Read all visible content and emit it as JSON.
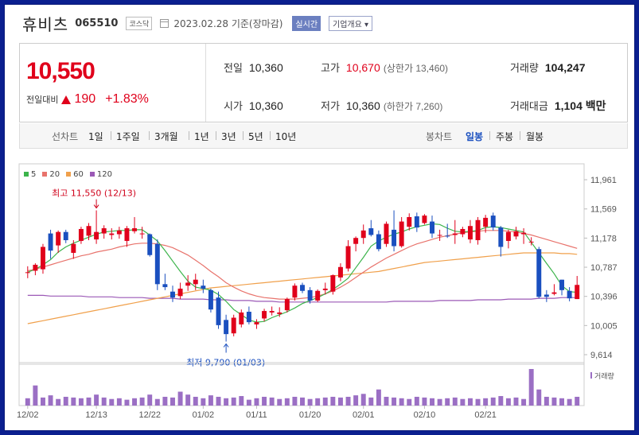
{
  "header": {
    "name": "휴비츠",
    "code": "065510",
    "market": "코스닥",
    "date_text": "2023.02.28 기준(장마감)",
    "realtime_label": "실시간",
    "company_label": "기업개요 ▾"
  },
  "price": {
    "current": "10,550",
    "change_label": "전일대비",
    "change": "190",
    "change_pct": "+1.83%"
  },
  "metrics": {
    "prev_close_label": "전일",
    "prev_close": "10,360",
    "high_label": "고가",
    "high": "10,670",
    "upper_limit": "(상한가 13,460)",
    "volume_label": "거래량",
    "volume": "104,247",
    "open_label": "시가",
    "open": "10,360",
    "low_label": "저가",
    "low": "10,360",
    "lower_limit": "(하한가 7,260)",
    "amount_label": "거래대금",
    "amount": "1,104 백만"
  },
  "periods": {
    "line_label": "선차트",
    "line_items": [
      "1일",
      "1주일",
      "3개월",
      "1년",
      "3년",
      "5년",
      "10년"
    ],
    "candle_label": "봉차트",
    "candle_items": [
      "일봉",
      "주봉",
      "월봉"
    ],
    "candle_active": "일봉"
  },
  "colors": {
    "up": "#e0001b",
    "down": "#1a4fbf",
    "ma5": "#3cb44b",
    "ma20": "#e8736c",
    "ma60": "#f0a04b",
    "ma120": "#9b59b6",
    "volume": "#9b6fc4"
  },
  "chart_data": {
    "type": "candlestick",
    "legend": [
      "5",
      "20",
      "60",
      "120"
    ],
    "y_ticks": [
      "11,961",
      "11,569",
      "11,178",
      "10,787",
      "10,396",
      "10,005",
      "9,614"
    ],
    "ylim": [
      9614,
      11961
    ],
    "x_ticks": [
      "12/02",
      "12/13",
      "12/22",
      "01/02",
      "01/11",
      "01/20",
      "02/01",
      "02/10",
      "02/21"
    ],
    "annotations": {
      "high": "최고 11,550 (12/13)",
      "low": "최저 9,790 (01/03)"
    },
    "volume_label": "거래량",
    "candles": [
      {
        "o": 10720,
        "h": 10800,
        "l": 10640,
        "c": 10720
      },
      {
        "o": 10740,
        "h": 10840,
        "l": 10680,
        "c": 10820
      },
      {
        "o": 10760,
        "h": 11100,
        "l": 10700,
        "c": 11060
      },
      {
        "o": 11240,
        "h": 11290,
        "l": 10900,
        "c": 11010
      },
      {
        "o": 11080,
        "h": 11280,
        "l": 10980,
        "c": 11260
      },
      {
        "o": 11260,
        "h": 11290,
        "l": 11110,
        "c": 11150
      },
      {
        "o": 10980,
        "h": 11150,
        "l": 10900,
        "c": 11100
      },
      {
        "o": 11140,
        "h": 11330,
        "l": 11100,
        "c": 11300
      },
      {
        "o": 11210,
        "h": 11380,
        "l": 11150,
        "c": 11340
      },
      {
        "o": 11160,
        "h": 11550,
        "l": 11100,
        "c": 11260
      },
      {
        "o": 11240,
        "h": 11350,
        "l": 11170,
        "c": 11310
      },
      {
        "o": 11220,
        "h": 11310,
        "l": 11160,
        "c": 11240
      },
      {
        "o": 11230,
        "h": 11330,
        "l": 11170,
        "c": 11280
      },
      {
        "o": 11140,
        "h": 11340,
        "l": 11060,
        "c": 11310
      },
      {
        "o": 11270,
        "h": 11460,
        "l": 11240,
        "c": 11310
      },
      {
        "o": 11230,
        "h": 11330,
        "l": 11170,
        "c": 11240
      },
      {
        "o": 11230,
        "h": 11240,
        "l": 10930,
        "c": 10950
      },
      {
        "o": 11100,
        "h": 11160,
        "l": 10480,
        "c": 10560
      },
      {
        "o": 10560,
        "h": 10700,
        "l": 10480,
        "c": 10520
      },
      {
        "o": 10460,
        "h": 10540,
        "l": 10320,
        "c": 10380
      },
      {
        "o": 10400,
        "h": 10580,
        "l": 10360,
        "c": 10500
      },
      {
        "o": 10540,
        "h": 10680,
        "l": 10470,
        "c": 10580
      },
      {
        "o": 10560,
        "h": 10700,
        "l": 10480,
        "c": 10620
      },
      {
        "o": 10540,
        "h": 10620,
        "l": 10440,
        "c": 10500
      },
      {
        "o": 10480,
        "h": 10500,
        "l": 10180,
        "c": 10220
      },
      {
        "o": 10380,
        "h": 10460,
        "l": 9960,
        "c": 10010
      },
      {
        "o": 10080,
        "h": 10150,
        "l": 9790,
        "c": 9890
      },
      {
        "o": 9900,
        "h": 10150,
        "l": 9860,
        "c": 10110
      },
      {
        "o": 10020,
        "h": 10220,
        "l": 9980,
        "c": 10180
      },
      {
        "o": 10190,
        "h": 10260,
        "l": 10020,
        "c": 10050
      },
      {
        "o": 10020,
        "h": 10090,
        "l": 9960,
        "c": 10050
      },
      {
        "o": 10100,
        "h": 10230,
        "l": 10060,
        "c": 10200
      },
      {
        "o": 10180,
        "h": 10260,
        "l": 10140,
        "c": 10200
      },
      {
        "o": 10160,
        "h": 10250,
        "l": 10120,
        "c": 10180
      },
      {
        "o": 10210,
        "h": 10380,
        "l": 10180,
        "c": 10360
      },
      {
        "o": 10380,
        "h": 10570,
        "l": 10340,
        "c": 10540
      },
      {
        "o": 10550,
        "h": 10580,
        "l": 10440,
        "c": 10470
      },
      {
        "o": 10480,
        "h": 10520,
        "l": 10300,
        "c": 10340
      },
      {
        "o": 10340,
        "h": 10490,
        "l": 10320,
        "c": 10470
      },
      {
        "o": 10480,
        "h": 10580,
        "l": 10420,
        "c": 10500
      },
      {
        "o": 10460,
        "h": 10690,
        "l": 10420,
        "c": 10680
      },
      {
        "o": 10650,
        "h": 10840,
        "l": 10600,
        "c": 10790
      },
      {
        "o": 10770,
        "h": 11150,
        "l": 10730,
        "c": 11070
      },
      {
        "o": 11100,
        "h": 11200,
        "l": 11000,
        "c": 11180
      },
      {
        "o": 11180,
        "h": 11360,
        "l": 11100,
        "c": 11280
      },
      {
        "o": 11310,
        "h": 11420,
        "l": 11200,
        "c": 11220
      },
      {
        "o": 11230,
        "h": 11280,
        "l": 11000,
        "c": 11030
      },
      {
        "o": 11100,
        "h": 11400,
        "l": 11060,
        "c": 11370
      },
      {
        "o": 11290,
        "h": 11550,
        "l": 11000,
        "c": 11070
      },
      {
        "o": 11070,
        "h": 11460,
        "l": 11050,
        "c": 11400
      },
      {
        "o": 11330,
        "h": 11510,
        "l": 11280,
        "c": 11460
      },
      {
        "o": 11470,
        "h": 11520,
        "l": 11260,
        "c": 11320
      },
      {
        "o": 11380,
        "h": 11500,
        "l": 11360,
        "c": 11480
      },
      {
        "o": 11400,
        "h": 11480,
        "l": 11180,
        "c": 11240
      },
      {
        "o": 11210,
        "h": 11290,
        "l": 11140,
        "c": 11220
      },
      {
        "o": 11210,
        "h": 11370,
        "l": 11180,
        "c": 11200
      },
      {
        "o": 11220,
        "h": 11420,
        "l": 11100,
        "c": 11240
      },
      {
        "o": 11230,
        "h": 11330,
        "l": 11190,
        "c": 11300
      },
      {
        "o": 11160,
        "h": 11420,
        "l": 11110,
        "c": 11340
      },
      {
        "o": 11150,
        "h": 11460,
        "l": 11090,
        "c": 11420
      },
      {
        "o": 11330,
        "h": 11490,
        "l": 11250,
        "c": 11450
      },
      {
        "o": 11480,
        "h": 11520,
        "l": 11280,
        "c": 11320
      },
      {
        "o": 11320,
        "h": 11340,
        "l": 10930,
        "c": 11060
      },
      {
        "o": 11140,
        "h": 11290,
        "l": 11040,
        "c": 11260
      },
      {
        "o": 11200,
        "h": 11330,
        "l": 11160,
        "c": 11270
      },
      {
        "o": 11230,
        "h": 11310,
        "l": 11100,
        "c": 11250
      },
      {
        "o": 11130,
        "h": 11190,
        "l": 11080,
        "c": 11130
      },
      {
        "o": 11030,
        "h": 11060,
        "l": 10370,
        "c": 10390
      },
      {
        "o": 10420,
        "h": 10480,
        "l": 10320,
        "c": 10390
      },
      {
        "o": 10430,
        "h": 10560,
        "l": 10410,
        "c": 10450
      },
      {
        "o": 10620,
        "h": 10620,
        "l": 10410,
        "c": 10480
      },
      {
        "o": 10470,
        "h": 10520,
        "l": 10330,
        "c": 10370
      },
      {
        "o": 10360,
        "h": 10670,
        "l": 10360,
        "c": 10550
      }
    ],
    "ma5": [
      10720,
      10760,
      10820,
      10890,
      10990,
      11060,
      11110,
      11150,
      11190,
      11230,
      11260,
      11270,
      11280,
      11280,
      11290,
      11290,
      11220,
      11140,
      11010,
      10870,
      10730,
      10600,
      10520,
      10500,
      10480,
      10420,
      10330,
      10220,
      10150,
      10080,
      10050,
      10060,
      10110,
      10150,
      10190,
      10240,
      10300,
      10340,
      10380,
      10430,
      10490,
      10560,
      10640,
      10780,
      10920,
      11070,
      11140,
      11190,
      11230,
      11260,
      11300,
      11330,
      11350,
      11370,
      11360,
      11310,
      11270,
      11260,
      11270,
      11280,
      11320,
      11330,
      11320,
      11300,
      11280,
      11260,
      11120,
      10980,
      10840,
      10700,
      10540,
      10460,
      10450
    ],
    "ma20": [
      10740,
      10760,
      10790,
      10820,
      10850,
      10880,
      10910,
      10940,
      10960,
      10990,
      11010,
      11030,
      11060,
      11080,
      11100,
      11110,
      11110,
      11100,
      11080,
      11050,
      11000,
      10950,
      10880,
      10810,
      10730,
      10660,
      10580,
      10520,
      10470,
      10430,
      10400,
      10380,
      10370,
      10360,
      10360,
      10360,
      10370,
      10380,
      10400,
      10430,
      10470,
      10520,
      10580,
      10650,
      10720,
      10790,
      10850,
      10910,
      10960,
      11010,
      11060,
      11100,
      11130,
      11160,
      11190,
      11210,
      11230,
      11250,
      11260,
      11270,
      11280,
      11280,
      11280,
      11270,
      11260,
      11240,
      11220,
      11190,
      11160,
      11130,
      11100,
      11070,
      11040
    ],
    "ma60": [
      10030,
      10050,
      10070,
      10090,
      10110,
      10130,
      10150,
      10170,
      10190,
      10210,
      10230,
      10250,
      10270,
      10290,
      10310,
      10330,
      10350,
      10370,
      10390,
      10410,
      10430,
      10450,
      10470,
      10490,
      10510,
      10520,
      10530,
      10540,
      10550,
      10560,
      10570,
      10580,
      10590,
      10600,
      10610,
      10620,
      10630,
      10640,
      10650,
      10660,
      10670,
      10680,
      10690,
      10700,
      10710,
      10720,
      10730,
      10750,
      10770,
      10790,
      10810,
      10830,
      10850,
      10860,
      10870,
      10880,
      10890,
      10900,
      10910,
      10920,
      10930,
      10940,
      10950,
      10960,
      10970,
      10980,
      10980,
      10980,
      10980,
      10980,
      10970,
      10970,
      10960
    ],
    "ma120": [
      10410,
      10410,
      10410,
      10400,
      10400,
      10400,
      10400,
      10400,
      10390,
      10390,
      10390,
      10390,
      10380,
      10380,
      10380,
      10380,
      10370,
      10370,
      10370,
      10370,
      10360,
      10360,
      10360,
      10360,
      10350,
      10350,
      10350,
      10340,
      10340,
      10340,
      10330,
      10330,
      10330,
      10320,
      10320,
      10320,
      10320,
      10320,
      10320,
      10320,
      10320,
      10320,
      10320,
      10320,
      10320,
      10320,
      10320,
      10320,
      10330,
      10330,
      10330,
      10330,
      10330,
      10330,
      10340,
      10340,
      10340,
      10340,
      10340,
      10350,
      10350,
      10350,
      10350,
      10360,
      10360,
      10360,
      10360,
      10370,
      10370,
      10370,
      10380,
      10380,
      10380
    ],
    "volume": [
      20,
      55,
      22,
      28,
      18,
      24,
      22,
      20,
      22,
      30,
      22,
      18,
      20,
      16,
      20,
      22,
      30,
      18,
      24,
      22,
      38,
      30,
      24,
      20,
      28,
      24,
      20,
      22,
      26,
      16,
      20,
      24,
      22,
      18,
      20,
      24,
      22,
      18,
      20,
      22,
      24,
      22,
      24,
      28,
      32,
      22,
      44,
      24,
      22,
      20,
      18,
      24,
      22,
      20,
      18,
      20,
      22,
      18,
      20,
      18,
      20,
      22,
      26,
      20,
      22,
      18,
      100,
      44,
      24,
      22,
      20,
      18,
      24
    ],
    "volume_ymax": 100
  }
}
